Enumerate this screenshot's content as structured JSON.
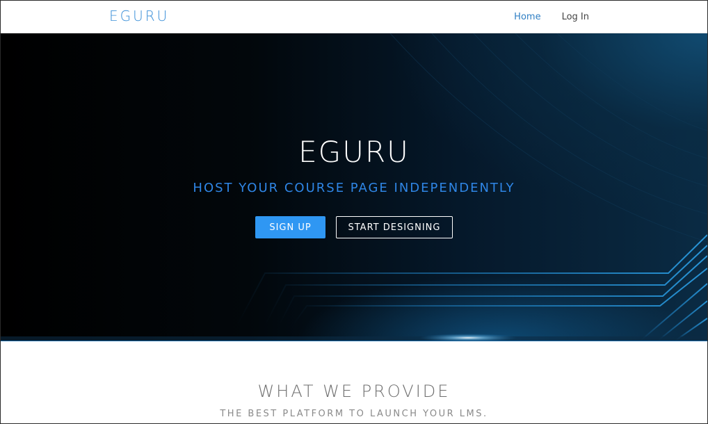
{
  "nav": {
    "brand": "EGURU",
    "links": [
      {
        "label": "Home",
        "active": true
      },
      {
        "label": "Log In",
        "active": false
      }
    ]
  },
  "hero": {
    "title": "EGURU",
    "subtitle": "HOST YOUR COURSE PAGE INDEPENDENTLY",
    "buttons": {
      "signup": "SIGN UP",
      "design": "START DESIGNING"
    }
  },
  "provide": {
    "title": "WHAT WE PROVIDE",
    "subtitle": "THE BEST PLATFORM TO LAUNCH YOUR LMS."
  },
  "colors": {
    "brand_blue": "#3a8fd8",
    "subtitle_blue": "#2f86e6",
    "signup_button": "#2f97f3",
    "hero_dark": "#000000",
    "circuit_line": "#1e7fc0"
  }
}
